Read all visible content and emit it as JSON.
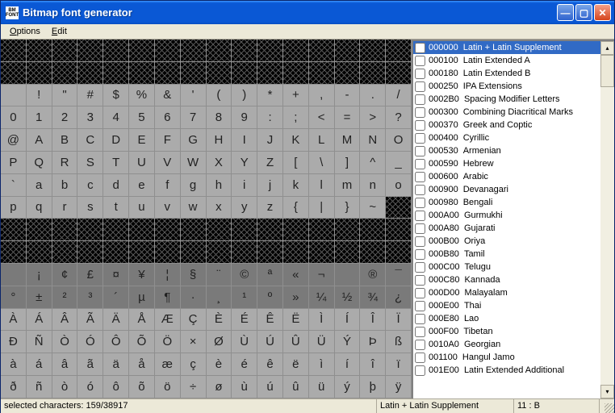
{
  "window": {
    "title": "Bitmap font generator",
    "icon_text": "BM\nFONT"
  },
  "menu": {
    "options": "Options",
    "edit": "Edit"
  },
  "chars": {
    "row0": [
      "",
      "",
      "",
      "",
      "",
      "",
      "",
      "",
      "",
      "",
      "",
      "",
      "",
      "",
      "",
      ""
    ],
    "row1": [
      "",
      "",
      "",
      "",
      "",
      "",
      "",
      "",
      "",
      "",
      "",
      "",
      "",
      "",
      "",
      ""
    ],
    "row2": [
      "",
      "!",
      "\"",
      "#",
      "$",
      "%",
      "&",
      "'",
      "(",
      ")",
      "*",
      "+",
      ",",
      "-",
      ".",
      "/"
    ],
    "row3": [
      "0",
      "1",
      "2",
      "3",
      "4",
      "5",
      "6",
      "7",
      "8",
      "9",
      ":",
      ";",
      "<",
      "=",
      ">",
      "?"
    ],
    "row4": [
      "@",
      "A",
      "B",
      "C",
      "D",
      "E",
      "F",
      "G",
      "H",
      "I",
      "J",
      "K",
      "L",
      "M",
      "N",
      "O"
    ],
    "row5": [
      "P",
      "Q",
      "R",
      "S",
      "T",
      "U",
      "V",
      "W",
      "X",
      "Y",
      "Z",
      "[",
      "\\",
      "]",
      "^",
      "_"
    ],
    "row6": [
      "`",
      "a",
      "b",
      "c",
      "d",
      "e",
      "f",
      "g",
      "h",
      "i",
      "j",
      "k",
      "l",
      "m",
      "n",
      "o"
    ],
    "row7": [
      "p",
      "q",
      "r",
      "s",
      "t",
      "u",
      "v",
      "w",
      "x",
      "y",
      "z",
      "{",
      "|",
      "}",
      "~",
      ""
    ],
    "row8": [
      "",
      "",
      "",
      "",
      "",
      "",
      "",
      "",
      "",
      "",
      "",
      "",
      "",
      "",
      "",
      ""
    ],
    "row9": [
      "",
      "",
      "",
      "",
      "",
      "",
      "",
      "",
      "",
      "",
      "",
      "",
      "",
      "",
      "",
      ""
    ],
    "row10": [
      "",
      "¡",
      "¢",
      "£",
      "¤",
      "¥",
      "¦",
      "§",
      "¨",
      "©",
      "ª",
      "«",
      "¬",
      "­",
      "®",
      "¯"
    ],
    "row11": [
      "°",
      "±",
      "²",
      "³",
      "´",
      "µ",
      "¶",
      "·",
      "¸",
      "¹",
      "º",
      "»",
      "¼",
      "½",
      "¾",
      "¿"
    ],
    "row12": [
      "À",
      "Á",
      "Â",
      "Ã",
      "Ä",
      "Å",
      "Æ",
      "Ç",
      "È",
      "É",
      "Ê",
      "Ë",
      "Ì",
      "Í",
      "Î",
      "Ï"
    ],
    "row13": [
      "Ð",
      "Ñ",
      "Ò",
      "Ó",
      "Ô",
      "Õ",
      "Ö",
      "×",
      "Ø",
      "Ù",
      "Ú",
      "Û",
      "Ü",
      "Ý",
      "Þ",
      "ß"
    ],
    "row14": [
      "à",
      "á",
      "â",
      "ã",
      "ä",
      "å",
      "æ",
      "ç",
      "è",
      "é",
      "ê",
      "ë",
      "ì",
      "í",
      "î",
      "ï"
    ],
    "row15": [
      "ð",
      "ñ",
      "ò",
      "ó",
      "ô",
      "õ",
      "ö",
      "÷",
      "ø",
      "ù",
      "ú",
      "û",
      "ü",
      "ý",
      "þ",
      "ÿ"
    ]
  },
  "ranges": [
    {
      "code": "000000",
      "name": "Latin + Latin Supplement",
      "selected": true
    },
    {
      "code": "000100",
      "name": "Latin Extended A"
    },
    {
      "code": "000180",
      "name": "Latin Extended B"
    },
    {
      "code": "000250",
      "name": "IPA Extensions"
    },
    {
      "code": "0002B0",
      "name": "Spacing Modifier Letters"
    },
    {
      "code": "000300",
      "name": "Combining Diacritical Marks"
    },
    {
      "code": "000370",
      "name": "Greek and Coptic"
    },
    {
      "code": "000400",
      "name": "Cyrillic"
    },
    {
      "code": "000530",
      "name": "Armenian"
    },
    {
      "code": "000590",
      "name": "Hebrew"
    },
    {
      "code": "000600",
      "name": "Arabic"
    },
    {
      "code": "000900",
      "name": "Devanagari"
    },
    {
      "code": "000980",
      "name": "Bengali"
    },
    {
      "code": "000A00",
      "name": "Gurmukhi"
    },
    {
      "code": "000A80",
      "name": "Gujarati"
    },
    {
      "code": "000B00",
      "name": "Oriya"
    },
    {
      "code": "000B80",
      "name": "Tamil"
    },
    {
      "code": "000C00",
      "name": "Telugu"
    },
    {
      "code": "000C80",
      "name": "Kannada"
    },
    {
      "code": "000D00",
      "name": "Malayalam"
    },
    {
      "code": "000E00",
      "name": "Thai"
    },
    {
      "code": "000E80",
      "name": "Lao"
    },
    {
      "code": "000F00",
      "name": "Tibetan"
    },
    {
      "code": "0010A0",
      "name": "Georgian"
    },
    {
      "code": "001100",
      "name": "Hangul Jamo"
    },
    {
      "code": "001E00",
      "name": "Latin Extended Additional"
    }
  ],
  "status": {
    "selected": "selected characters: 159/38917",
    "range": "Latin + Latin Supplement",
    "coord": "11 : B"
  }
}
